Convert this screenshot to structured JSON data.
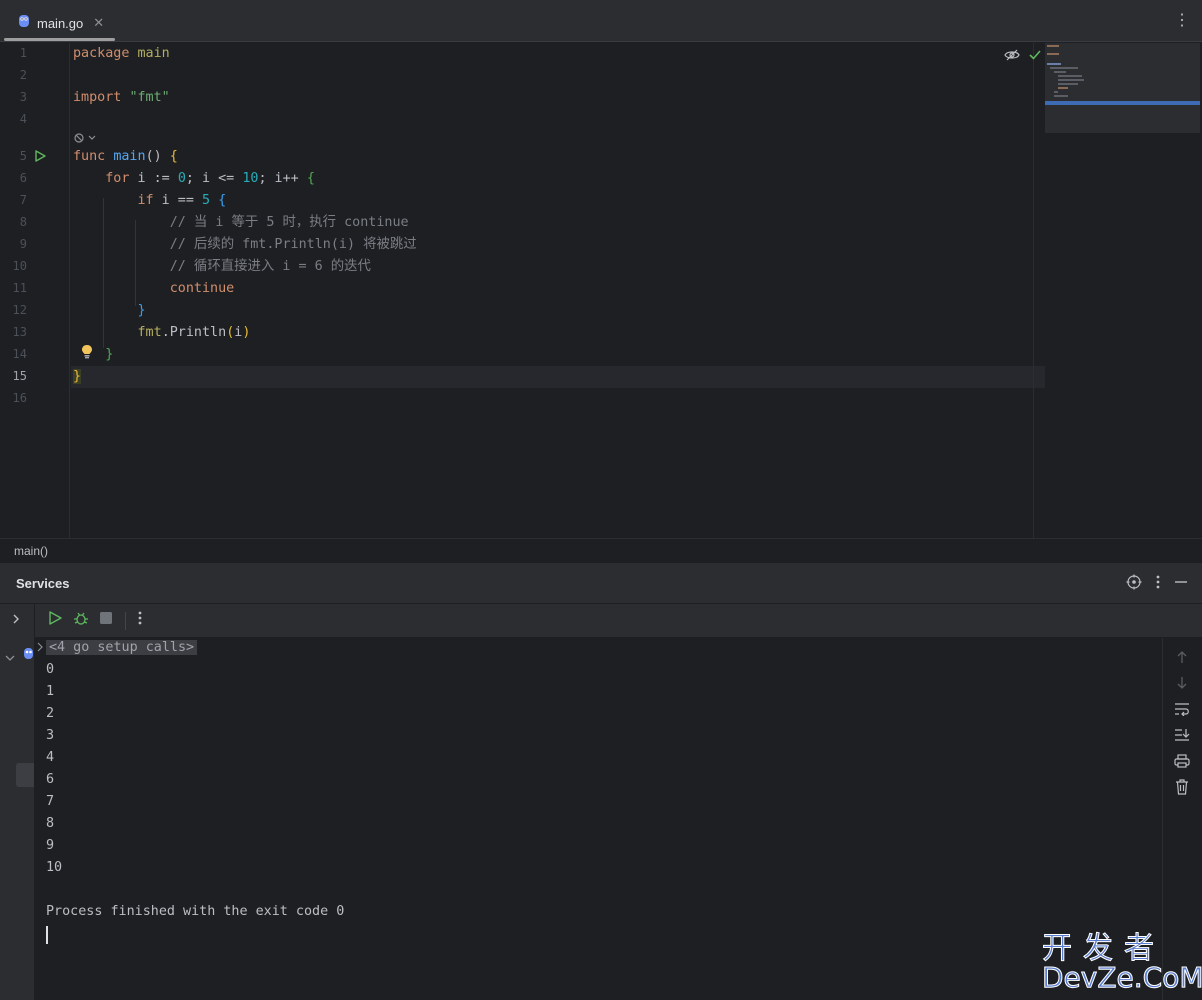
{
  "tab": {
    "title": "main.go",
    "close": "✕",
    "menu": "⋮"
  },
  "editor": {
    "line_numbers": [
      "1",
      "2",
      "3",
      "4",
      "5",
      "6",
      "7",
      "8",
      "9",
      "10",
      "11",
      "12",
      "13",
      "14",
      "15",
      "16"
    ],
    "current_line": "15",
    "code": {
      "l1_kw": "package",
      "l1_name": "main",
      "l3_kw": "import",
      "l3_str": "\"fmt\"",
      "l5_kw": "func",
      "l5_fn": "main",
      "l5_parens": "()",
      "l5_brace": "{",
      "l6_kw": "for",
      "l6_a": " i := ",
      "l6_n0": "0",
      "l6_b": "; i <= ",
      "l6_n10": "10",
      "l6_c": "; i++ ",
      "l6_brace": "{",
      "l7_kw": "if",
      "l7_a": " i == ",
      "l7_n5": "5",
      "l7_brace": "{",
      "l8_cm": "// 当 i 等于 5 时，执行 continue",
      "l9_cm": "// 后续的 fmt.Println(i) 将被跳过",
      "l10_cm": "// 循环直接进入 i = 6 的迭代",
      "l11_kw": "continue",
      "l12_brace": "}",
      "l13_pkg": "fmt",
      "l13_dot": ".",
      "l13_fn": "Println",
      "l13_open": "(",
      "l13_arg": "i",
      "l13_close": ")",
      "l14_brace": "}",
      "l15_brace": "}"
    }
  },
  "breadcrumb": "main()",
  "services": {
    "title": "Services",
    "console": {
      "setup_calls": "<4 go setup calls>",
      "output": [
        "0",
        "1",
        "2",
        "3",
        "4",
        "6",
        "7",
        "8",
        "9",
        "10"
      ],
      "finished": "Process finished with the exit code 0"
    }
  },
  "watermark": {
    "top": "开发者",
    "bottom": "DevZe.CoM"
  },
  "colors": {
    "keyword": "#cf8e6d",
    "function": "#56a8f5",
    "string": "#6aab73",
    "number": "#2aacb8",
    "comment": "#7a7e85",
    "run_green": "#5fb85f"
  }
}
